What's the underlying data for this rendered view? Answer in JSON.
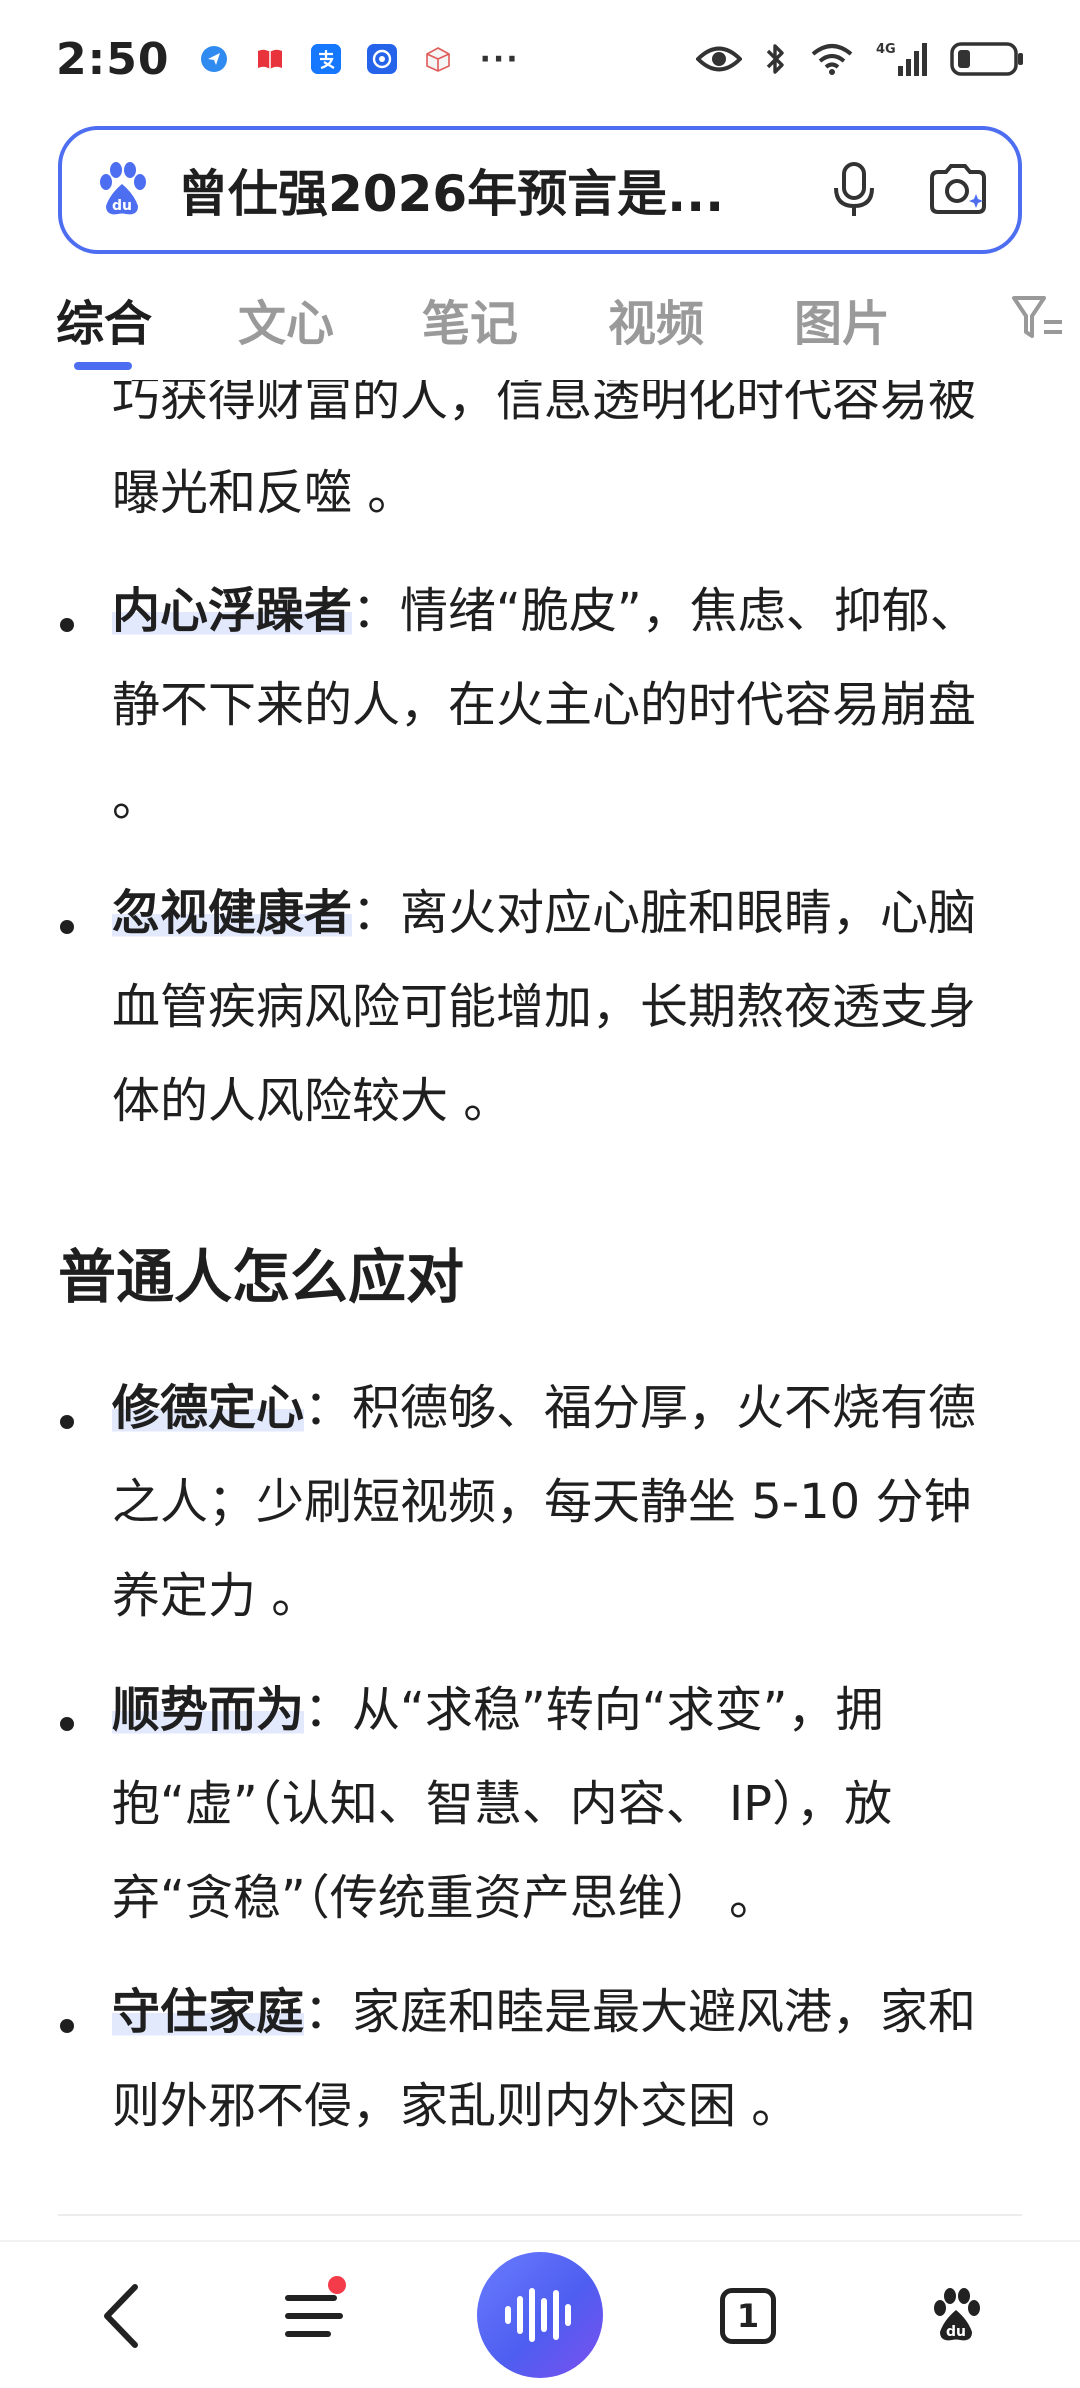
{
  "status_bar": {
    "time": "2:50",
    "more": "···",
    "network": "4G",
    "notification_icons": [
      "map-pin-app-icon",
      "book-app-icon",
      "alipay-icon",
      "app-store-icon",
      "cube-app-icon"
    ]
  },
  "search": {
    "query": "曾仕强2026年预言是..."
  },
  "tabs": [
    {
      "label": "综合",
      "active": true
    },
    {
      "label": "文心",
      "active": false
    },
    {
      "label": "笔记",
      "active": false
    },
    {
      "label": "视频",
      "active": false
    },
    {
      "label": "图片",
      "active": false
    }
  ],
  "content": {
    "top_continuation": "巧获得财富的人，信息透明化时代容易被曝光和反噬 。",
    "risk_items": [
      {
        "term": "内心浮躁者",
        "text": "：情绪“脆皮”，焦虑、抑郁、静不下来的人，在火主心的时代容易崩盘 。"
      },
      {
        "term": "忽视健康者",
        "text": "：离火对应心脏和眼睛，心脑血管疾病风险可能增加，长期熬夜透支身体的人风险较大 。"
      }
    ],
    "section_title": "普通人怎么应对",
    "advice_items": [
      {
        "term": "修德定心",
        "text": "：积德够、福分厚，火不烧有德之人；少刷短视频，每天静坐 5-10 分钟养定力 。"
      },
      {
        "term": "顺势而为",
        "text": "：从“求稳”转向“求变”，拥抱“虚”（认知、智慧、内容、 IP），放弃“贪稳”（传统重资产思维） 。"
      },
      {
        "term": "守住家庭",
        "text": "：家庭和睦是最大避风港，家和则外邪不侵，家乱则内外交困 。"
      }
    ]
  },
  "bottom_nav": {
    "tab_count": "1"
  },
  "colors": {
    "accent": "#4e6ef2",
    "highlight": "#e3e9fd",
    "badge": "#f43b4a"
  }
}
